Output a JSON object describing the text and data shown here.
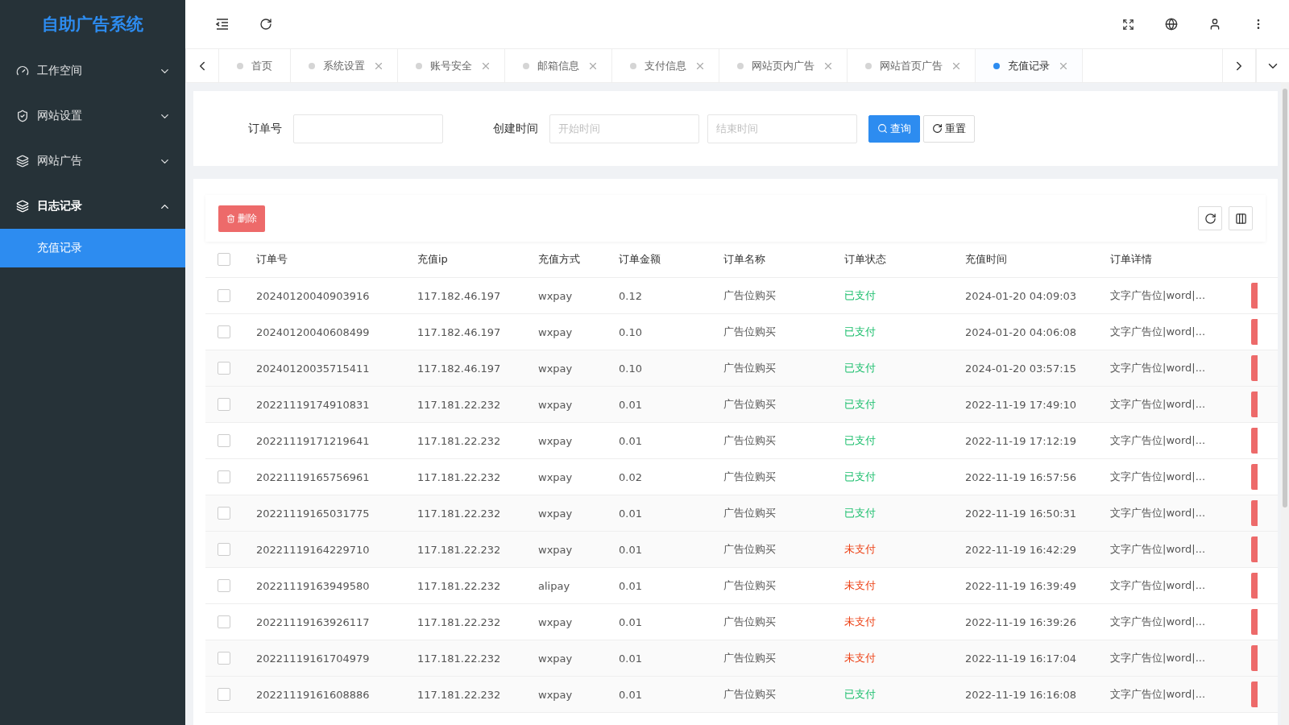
{
  "sidebar": {
    "logo": "自助广告系统",
    "items": [
      {
        "label": "工作空间",
        "expanded": false
      },
      {
        "label": "网站设置",
        "expanded": false
      },
      {
        "label": "网站广告",
        "expanded": false
      },
      {
        "label": "日志记录",
        "expanded": true,
        "children": [
          {
            "label": "充值记录",
            "selected": true
          }
        ]
      }
    ]
  },
  "tabs": [
    {
      "label": "首页",
      "selected": false,
      "closable": false
    },
    {
      "label": "系统设置",
      "selected": false,
      "closable": true
    },
    {
      "label": "账号安全",
      "selected": false,
      "closable": true
    },
    {
      "label": "邮箱信息",
      "selected": false,
      "closable": true
    },
    {
      "label": "支付信息",
      "selected": false,
      "closable": true
    },
    {
      "label": "网站页内广告",
      "selected": false,
      "closable": true
    },
    {
      "label": "网站首页广告",
      "selected": false,
      "closable": true
    },
    {
      "label": "充值记录",
      "selected": true,
      "closable": true
    }
  ],
  "search": {
    "order_label": "订单号",
    "time_label": "创建时间",
    "start_placeholder": "开始时间",
    "end_placeholder": "结束时间",
    "search_button": "查询",
    "reset_button": "重置"
  },
  "table": {
    "delete_button": "删除",
    "all_checked": false,
    "columns": [
      "订单号",
      "充值ip",
      "充值方式",
      "订单金额",
      "订单名称",
      "订单状态",
      "充值时间",
      "订单详情"
    ],
    "rows": [
      {
        "order": "20240120040903916",
        "ip": "117.182.46.197",
        "method": "wxpay",
        "amount": "0.12",
        "name": "广告位购买",
        "status": "已支付",
        "paid": true,
        "time": "2024-01-20 04:09:03",
        "detail": "文字广告位|word|...",
        "checked": false
      },
      {
        "order": "20240120040608499",
        "ip": "117.182.46.197",
        "method": "wxpay",
        "amount": "0.10",
        "name": "广告位购买",
        "status": "已支付",
        "paid": true,
        "time": "2024-01-20 04:06:08",
        "detail": "文字广告位|word|...",
        "checked": false
      },
      {
        "order": "20240120035715411",
        "ip": "117.182.46.197",
        "method": "wxpay",
        "amount": "0.10",
        "name": "广告位购买",
        "status": "已支付",
        "paid": true,
        "time": "2024-01-20 03:57:15",
        "detail": "文字广告位|word|...",
        "checked": false
      },
      {
        "order": "20221119174910831",
        "ip": "117.181.22.232",
        "method": "wxpay",
        "amount": "0.01",
        "name": "广告位购买",
        "status": "已支付",
        "paid": true,
        "time": "2022-11-19 17:49:10",
        "detail": "文字广告位|word|...",
        "checked": false
      },
      {
        "order": "20221119171219641",
        "ip": "117.181.22.232",
        "method": "wxpay",
        "amount": "0.01",
        "name": "广告位购买",
        "status": "已支付",
        "paid": true,
        "time": "2022-11-19 17:12:19",
        "detail": "文字广告位|word|...",
        "checked": false
      },
      {
        "order": "20221119165756961",
        "ip": "117.181.22.232",
        "method": "wxpay",
        "amount": "0.02",
        "name": "广告位购买",
        "status": "已支付",
        "paid": true,
        "time": "2022-11-19 16:57:56",
        "detail": "文字广告位|word|...",
        "checked": false
      },
      {
        "order": "20221119165031775",
        "ip": "117.181.22.232",
        "method": "wxpay",
        "amount": "0.01",
        "name": "广告位购买",
        "status": "已支付",
        "paid": true,
        "time": "2022-11-19 16:50:31",
        "detail": "文字广告位|word|...",
        "checked": false
      },
      {
        "order": "20221119164229710",
        "ip": "117.181.22.232",
        "method": "wxpay",
        "amount": "0.01",
        "name": "广告位购买",
        "status": "未支付",
        "paid": false,
        "time": "2022-11-19 16:42:29",
        "detail": "文字广告位|word|...",
        "checked": false
      },
      {
        "order": "20221119163949580",
        "ip": "117.181.22.232",
        "method": "alipay",
        "amount": "0.01",
        "name": "广告位购买",
        "status": "未支付",
        "paid": false,
        "time": "2022-11-19 16:39:49",
        "detail": "文字广告位|word|...",
        "checked": false
      },
      {
        "order": "20221119163926117",
        "ip": "117.181.22.232",
        "method": "wxpay",
        "amount": "0.01",
        "name": "广告位购买",
        "status": "未支付",
        "paid": false,
        "time": "2022-11-19 16:39:26",
        "detail": "文字广告位|word|...",
        "checked": false
      },
      {
        "order": "20221119161704979",
        "ip": "117.181.22.232",
        "method": "wxpay",
        "amount": "0.01",
        "name": "广告位购买",
        "status": "未支付",
        "paid": false,
        "time": "2022-11-19 16:17:04",
        "detail": "文字广告位|word|...",
        "checked": false
      },
      {
        "order": "20221119161608886",
        "ip": "117.181.22.232",
        "method": "wxpay",
        "amount": "0.01",
        "name": "广告位购买",
        "status": "已支付",
        "paid": true,
        "time": "2022-11-19 16:16:08",
        "detail": "文字广告位|word|...",
        "checked": false
      }
    ]
  }
}
